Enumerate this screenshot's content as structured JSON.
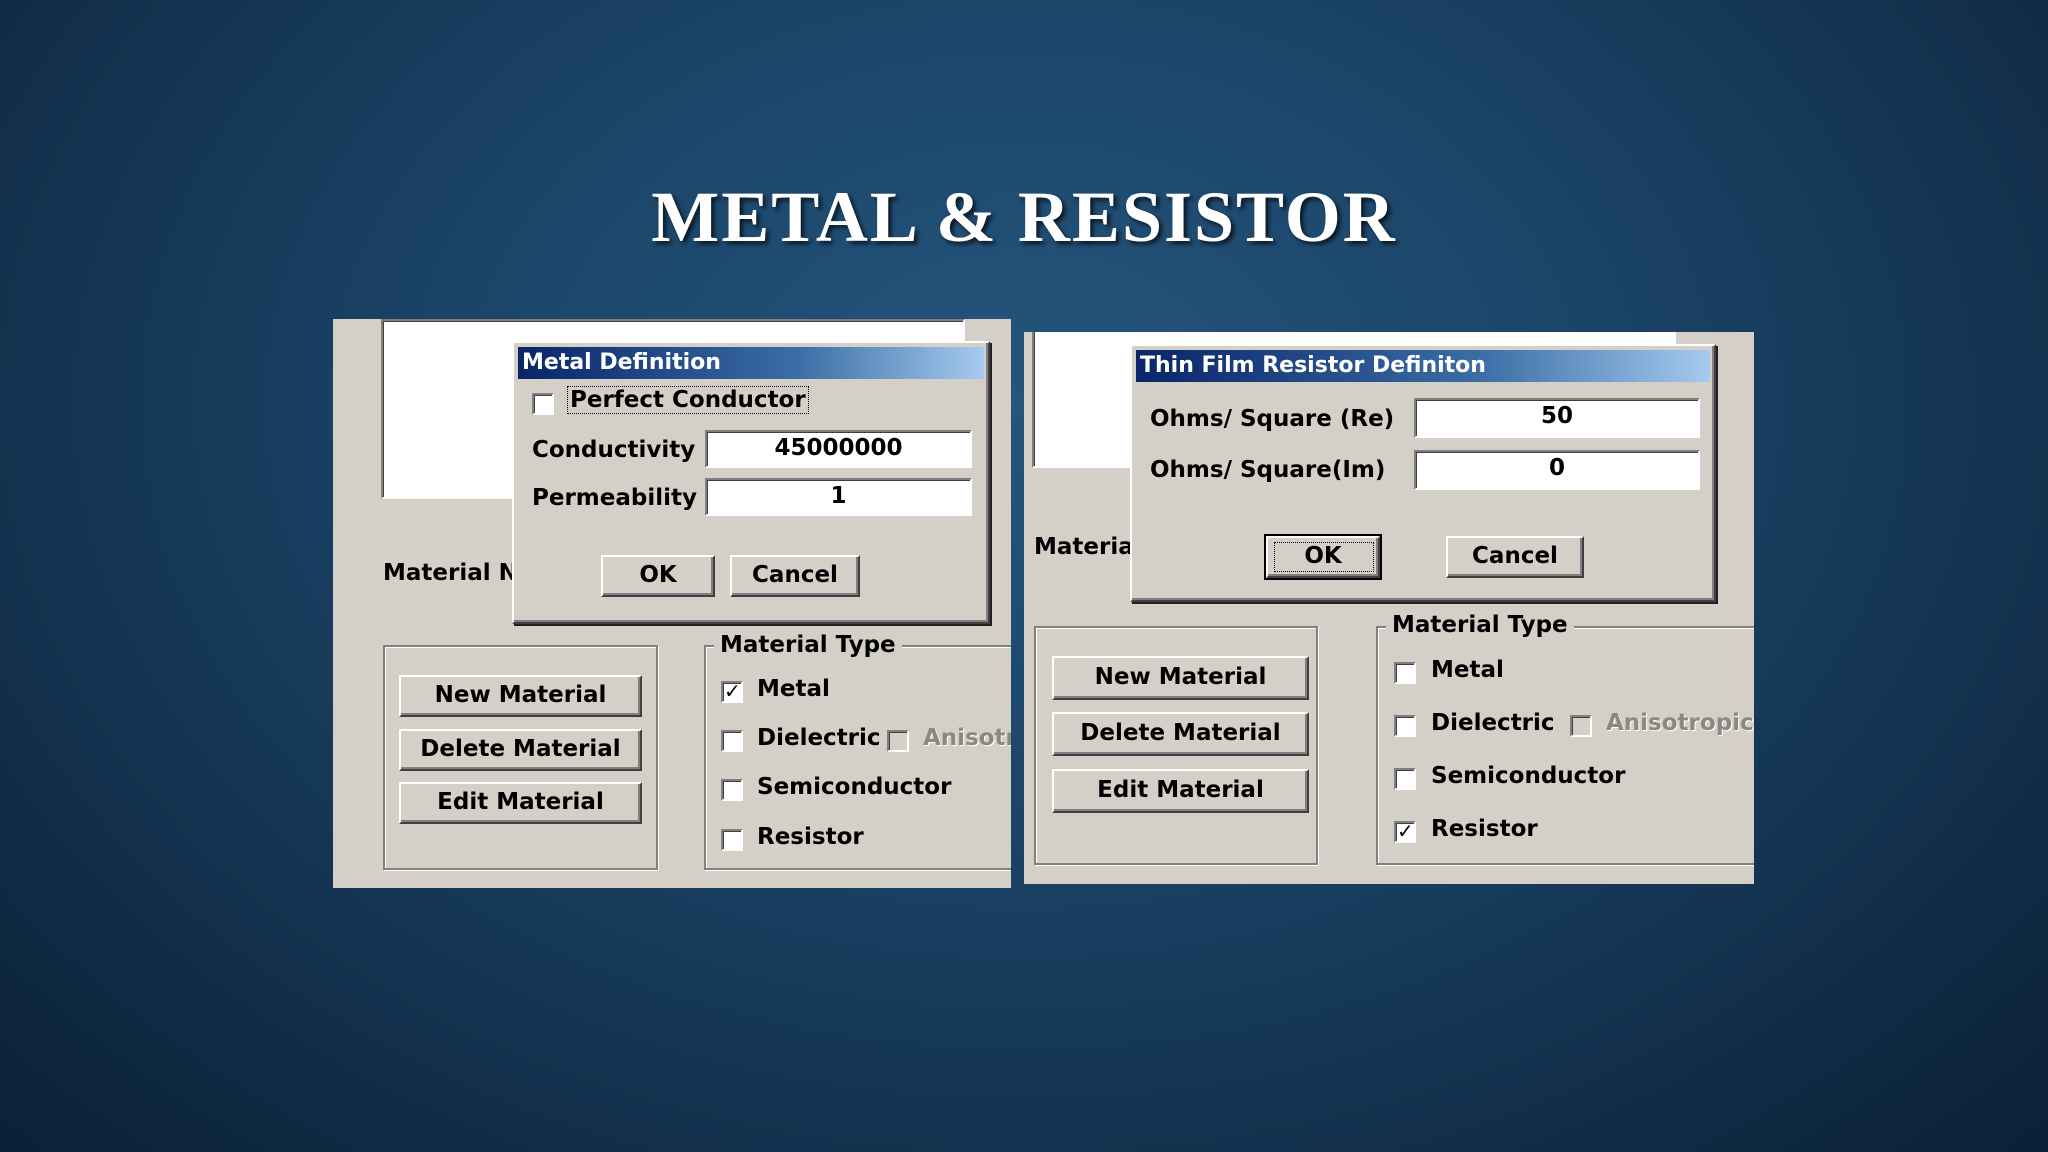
{
  "slide": {
    "title": "METAL & RESISTOR"
  },
  "left_panel": {
    "material_name_label": "Material Nar",
    "buttons": {
      "new": "New Material",
      "delete": "Delete  Material",
      "edit": "Edit  Material"
    },
    "material_type": {
      "label": "Material Type",
      "options": [
        {
          "label": "Metal",
          "checked": true
        },
        {
          "label": "Dielectric",
          "checked": false
        },
        {
          "label": "Anisotro",
          "checked": false,
          "disabled": true
        },
        {
          "label": "Semiconductor",
          "checked": false
        },
        {
          "label": "Resistor",
          "checked": false
        }
      ]
    },
    "dialog": {
      "title": "Metal Definition",
      "perfect_conductor": {
        "label": "Perfect Conductor",
        "checked": false
      },
      "conductivity": {
        "label": "Conductivity",
        "value": "45000000"
      },
      "permeability": {
        "label": "Permeability",
        "value": "1"
      },
      "ok": "OK",
      "cancel": "Cancel"
    }
  },
  "right_panel": {
    "material_name_label": "Material",
    "buttons": {
      "new": "New Material",
      "delete": "Delete  Material",
      "edit": "Edit  Material"
    },
    "material_type": {
      "label": "Material Type",
      "options": [
        {
          "label": "Metal",
          "checked": false
        },
        {
          "label": "Dielectric",
          "checked": false
        },
        {
          "label": "Anisotropic",
          "checked": false,
          "disabled": true
        },
        {
          "label": "Semiconductor",
          "checked": false
        },
        {
          "label": "Resistor",
          "checked": true
        }
      ]
    },
    "dialog": {
      "title": "Thin Film Resistor Definiton",
      "ohms_re": {
        "label": "Ohms/ Square (Re)",
        "value": "50"
      },
      "ohms_im": {
        "label": "Ohms/ Square(Im)",
        "value": "0"
      },
      "ok": "OK",
      "cancel": "Cancel"
    }
  }
}
